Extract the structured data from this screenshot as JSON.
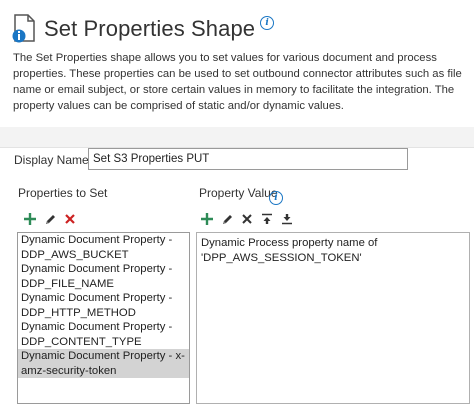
{
  "header": {
    "title": "Set Properties Shape",
    "info_icon": "info-icon"
  },
  "description": "The Set Properties shape allows you to set values for various document and process properties. These properties can be used to set outbound connector attributes such as file name or email subject, or store certain values in memory to facilitate the integration. The property values can be comprised of static and/or dynamic values.",
  "display_name": {
    "label": "Display Name",
    "value": "Set S3 Properties PUT"
  },
  "properties_panel": {
    "label": "Properties to Set",
    "toolbar": [
      "add-icon",
      "edit-pencil-icon",
      "delete-x-icon"
    ],
    "items": [
      "Dynamic Document Property - DDP_AWS_BUCKET",
      "Dynamic Document Property - DDP_FILE_NAME",
      "Dynamic Document Property - DDP_HTTP_METHOD",
      "Dynamic Document Property - DDP_CONTENT_TYPE",
      "Dynamic Document Property - x-amz-security-token"
    ],
    "selected_index": 4
  },
  "value_panel": {
    "label": "Property Value",
    "toolbar": [
      "add-icon",
      "edit-pencil-icon",
      "delete-x-icon",
      "move-up-icon",
      "move-down-icon"
    ],
    "content": "Dynamic Process property name of 'DPP_AWS_SESSION_TOKEN'"
  },
  "colors": {
    "accent_blue": "#1a76c4",
    "add_green": "#2e8b57",
    "delete_red": "#cc2222",
    "selected_row": "#d3d3d3"
  }
}
